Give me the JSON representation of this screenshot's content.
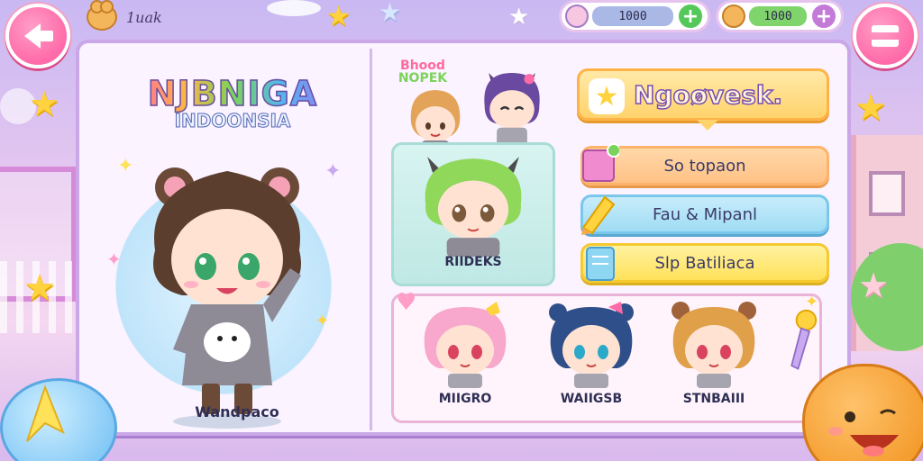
{
  "header": {
    "user_name": "1uak",
    "currency_1": {
      "value": "1000",
      "plus_label": "+"
    },
    "currency_2": {
      "value": "1000",
      "plus_label": "+"
    }
  },
  "logo": {
    "title": "NJBNIGA",
    "subtitle": "INDOONSIA"
  },
  "hero": {
    "name": "Wandpaco"
  },
  "sticker_tag": {
    "line1": "Bhood",
    "line2": "NOPEK"
  },
  "featured": {
    "name": "RIIDEKS"
  },
  "title_banner": {
    "text": "Ngoøvesk."
  },
  "menu": [
    {
      "label": "So topaon"
    },
    {
      "label": "Fau & Mipanl"
    },
    {
      "label": "Slp Batiliaca"
    }
  ],
  "roster": [
    {
      "name": "MIIGRO"
    },
    {
      "name": "WAIIGSB"
    },
    {
      "name": "STNBAIII"
    }
  ],
  "colors": {
    "accent_pink": "#ff6aa8",
    "accent_orange": "#ffb347",
    "accent_blue": "#8fd6f2",
    "accent_yellow": "#ffe15a",
    "currency_1_bar": "#aab8e6",
    "currency_1_plus": "#54c95a",
    "currency_2_bar": "#7fd46b",
    "currency_2_plus": "#c47bd8"
  }
}
